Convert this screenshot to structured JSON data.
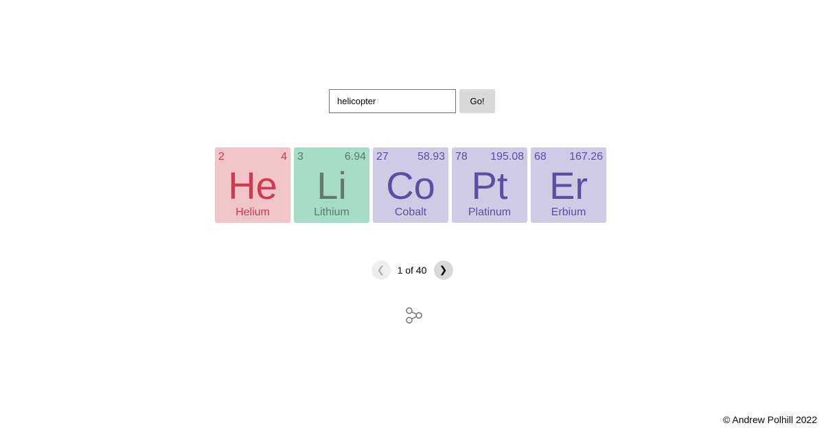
{
  "search": {
    "value": "helicopter",
    "button_label": "Go!"
  },
  "tiles": [
    {
      "number": "2",
      "mass": "4",
      "symbol": "He",
      "name": "Helium",
      "bg": "#f1c4c9",
      "fg": "#d3394e",
      "width": 110
    },
    {
      "number": "3",
      "mass": "6.94",
      "symbol": "Li",
      "name": "Lithium",
      "bg": "#a4dcc6",
      "fg": "#5f7a70",
      "width": 110
    },
    {
      "number": "27",
      "mass": "58.93",
      "symbol": "Co",
      "name": "Cobalt",
      "bg": "#cfcbe5",
      "fg": "#5b4ea4",
      "width": 110
    },
    {
      "number": "78",
      "mass": "195.08",
      "symbol": "Pt",
      "name": "Platinum",
      "bg": "#cfcbe5",
      "fg": "#5b4ea4",
      "width": 110
    },
    {
      "number": "68",
      "mass": "167.26",
      "symbol": "Er",
      "name": "Erbium",
      "bg": "#cfcbe5",
      "fg": "#5b4ea4",
      "width": 110
    }
  ],
  "pager": {
    "prev_icon": "chevron-left-icon",
    "next_icon": "chevron-right-icon",
    "prev_glyph": "❮",
    "next_glyph": "❯",
    "text": "1 of 40"
  },
  "share": {
    "icon": "share-icon"
  },
  "footer": {
    "text": "© Andrew Polhill 2022"
  }
}
